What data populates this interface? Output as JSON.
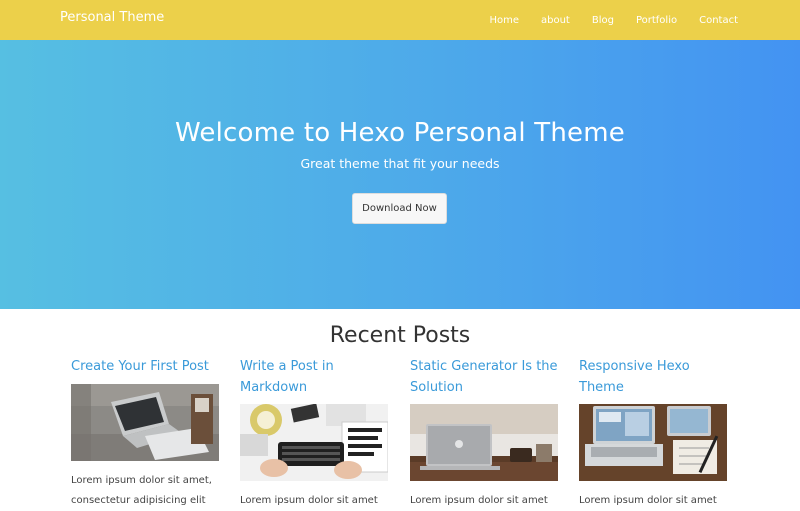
{
  "navbar": {
    "brand": "Personal Theme",
    "links": [
      "Home",
      "about",
      "Blog",
      "Portfolio",
      "Contact"
    ]
  },
  "hero": {
    "title": "Welcome to Hexo Personal Theme",
    "subtitle": "Great theme that fit your needs",
    "button_label": "Download Now"
  },
  "recent": {
    "heading": "Recent Posts",
    "posts": [
      {
        "title": "Create Your First Post",
        "excerpt": "Lorem ipsum dolor sit amet, consectetur adipisicing elit",
        "thumb_icon": "laptop-on-desk-image"
      },
      {
        "title": "Write a Post in Markdown",
        "excerpt": "Lorem ipsum dolor sit amet",
        "thumb_icon": "keyboard-desk-image"
      },
      {
        "title": "Static Generator Is the Solution",
        "excerpt": "Lorem ipsum dolor sit amet",
        "thumb_icon": "macbook-table-image"
      },
      {
        "title": "Responsive Hexo Theme",
        "excerpt": "Lorem ipsum dolor sit amet",
        "thumb_icon": "laptops-workspace-image"
      }
    ]
  },
  "colors": {
    "navbar": "#ecd04a",
    "hero_start": "#56bfe2",
    "hero_end": "#4393f2",
    "link": "#3a9ad9"
  }
}
